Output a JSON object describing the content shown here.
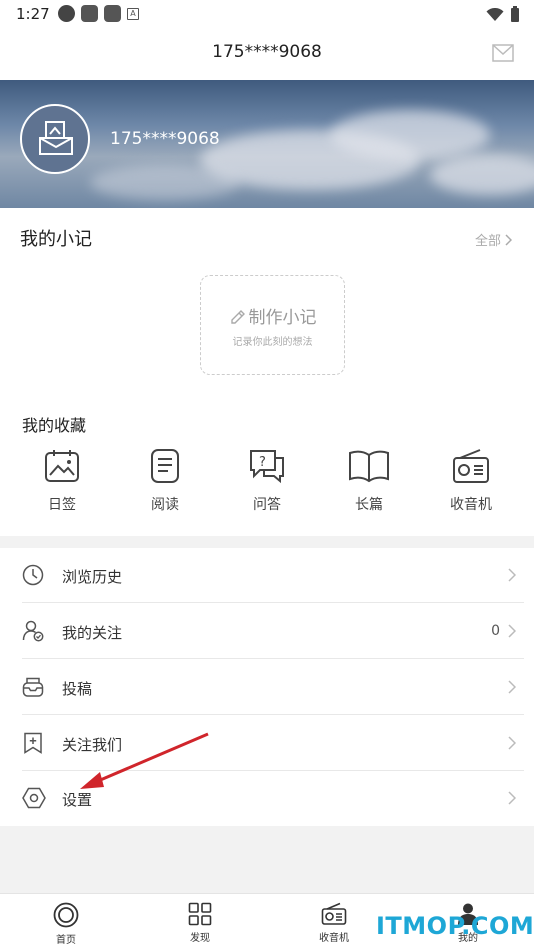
{
  "status_bar": {
    "time": "1:27",
    "icons": [
      "nav-circle-icon",
      "app-square-icon",
      "app-square-icon",
      "a-badge-icon",
      "wifi-icon",
      "battery-icon"
    ]
  },
  "header": {
    "title": "175****9068",
    "mail_icon": "mail-icon"
  },
  "profile": {
    "username": "175****9068"
  },
  "notes": {
    "title": "我的小记",
    "view_all": "全部",
    "make_note_title": "制作小记",
    "make_note_subtitle": "记录你此刻的想法"
  },
  "favorites": {
    "title": "我的收藏",
    "items": [
      {
        "label": "日签",
        "icon": "calendar-photo-icon"
      },
      {
        "label": "阅读",
        "icon": "document-icon"
      },
      {
        "label": "问答",
        "icon": "qa-bubbles-icon"
      },
      {
        "label": "长篇",
        "icon": "open-book-icon"
      },
      {
        "label": "收音机",
        "icon": "radio-icon"
      }
    ]
  },
  "menu": [
    {
      "label": "浏览历史",
      "icon": "clock-icon",
      "count": ""
    },
    {
      "label": "我的关注",
      "icon": "user-check-icon",
      "count": "0"
    },
    {
      "label": "投稿",
      "icon": "inbox-icon",
      "count": ""
    },
    {
      "label": "关注我们",
      "icon": "bookmark-plus-icon",
      "count": ""
    },
    {
      "label": "设置",
      "icon": "hexagon-settings-icon",
      "count": ""
    }
  ],
  "bottom_nav": [
    {
      "label": "首页",
      "icon": "home-ring-icon"
    },
    {
      "label": "发现",
      "icon": "grid-icon"
    },
    {
      "label": "收音机",
      "icon": "radio-icon"
    },
    {
      "label": "我的",
      "icon": "person-icon"
    }
  ],
  "watermark": "ITMOP.COM",
  "colors": {
    "accent_arrow": "#d0252b",
    "watermark": "#1ea7d6"
  }
}
